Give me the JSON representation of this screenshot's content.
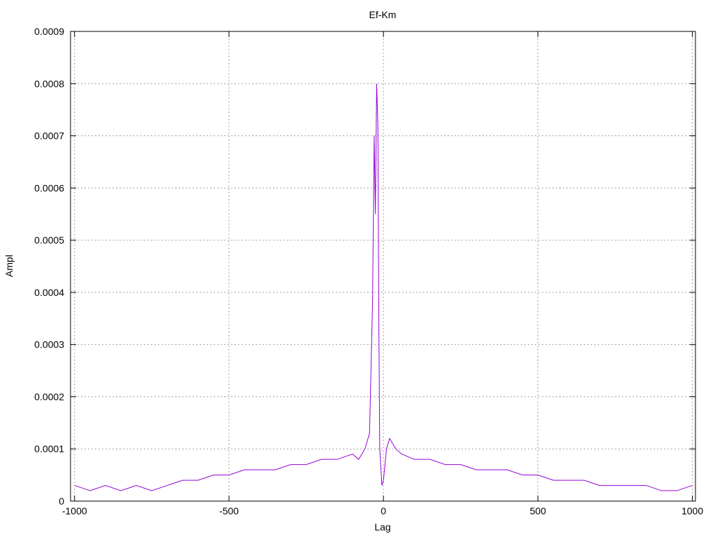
{
  "chart_data": {
    "type": "line",
    "title": "Ef-Km",
    "xlabel": "Lag",
    "ylabel": "Ampl",
    "xlim": [
      -1013,
      1010
    ],
    "ylim": [
      0,
      0.0009
    ],
    "x_ticks": [
      -1000,
      -500,
      0,
      500,
      1000
    ],
    "x_tick_labels": [
      "-1000",
      "-500",
      "0",
      "500",
      "1000"
    ],
    "y_ticks": [
      0,
      0.0001,
      0.0002,
      0.0003,
      0.0004,
      0.0005,
      0.0006,
      0.0007,
      0.0008,
      0.0009
    ],
    "y_tick_labels": [
      "0",
      "0.0001",
      "0.0002",
      "0.0003",
      "0.0004",
      "0.0005",
      "0.0006",
      "0.0007",
      "0.0008",
      "0.0009"
    ],
    "grid": true,
    "legend": "none",
    "color": "#9400d3",
    "series": [
      {
        "points": [
          [
            -1000,
            3e-05
          ],
          [
            -950,
            2e-05
          ],
          [
            -900,
            3e-05
          ],
          [
            -850,
            2e-05
          ],
          [
            -800,
            3e-05
          ],
          [
            -750,
            2e-05
          ],
          [
            -700,
            3e-05
          ],
          [
            -650,
            4e-05
          ],
          [
            -600,
            4e-05
          ],
          [
            -550,
            5e-05
          ],
          [
            -500,
            5e-05
          ],
          [
            -450,
            6e-05
          ],
          [
            -400,
            6e-05
          ],
          [
            -350,
            6e-05
          ],
          [
            -300,
            7e-05
          ],
          [
            -250,
            7e-05
          ],
          [
            -200,
            8e-05
          ],
          [
            -150,
            8e-05
          ],
          [
            -100,
            9e-05
          ],
          [
            -80,
            8e-05
          ],
          [
            -60,
            0.0001
          ],
          [
            -45,
            0.00013
          ],
          [
            -35,
            0.00039
          ],
          [
            -30,
            0.0007
          ],
          [
            -26,
            0.00055
          ],
          [
            -22,
            0.0008
          ],
          [
            -18,
            0.00072
          ],
          [
            -15,
            0.00035
          ],
          [
            -12,
            0.0001
          ],
          [
            -5,
            3e-05
          ],
          [
            0,
            4e-05
          ],
          [
            10,
            0.0001
          ],
          [
            20,
            0.00012
          ],
          [
            40,
            0.0001
          ],
          [
            60,
            9e-05
          ],
          [
            100,
            8e-05
          ],
          [
            150,
            8e-05
          ],
          [
            200,
            7e-05
          ],
          [
            250,
            7e-05
          ],
          [
            300,
            6e-05
          ],
          [
            350,
            6e-05
          ],
          [
            400,
            6e-05
          ],
          [
            450,
            5e-05
          ],
          [
            500,
            5e-05
          ],
          [
            550,
            4e-05
          ],
          [
            600,
            4e-05
          ],
          [
            650,
            4e-05
          ],
          [
            700,
            3e-05
          ],
          [
            750,
            3e-05
          ],
          [
            800,
            3e-05
          ],
          [
            850,
            3e-05
          ],
          [
            900,
            2e-05
          ],
          [
            950,
            2e-05
          ],
          [
            1000,
            3e-05
          ]
        ]
      }
    ]
  }
}
